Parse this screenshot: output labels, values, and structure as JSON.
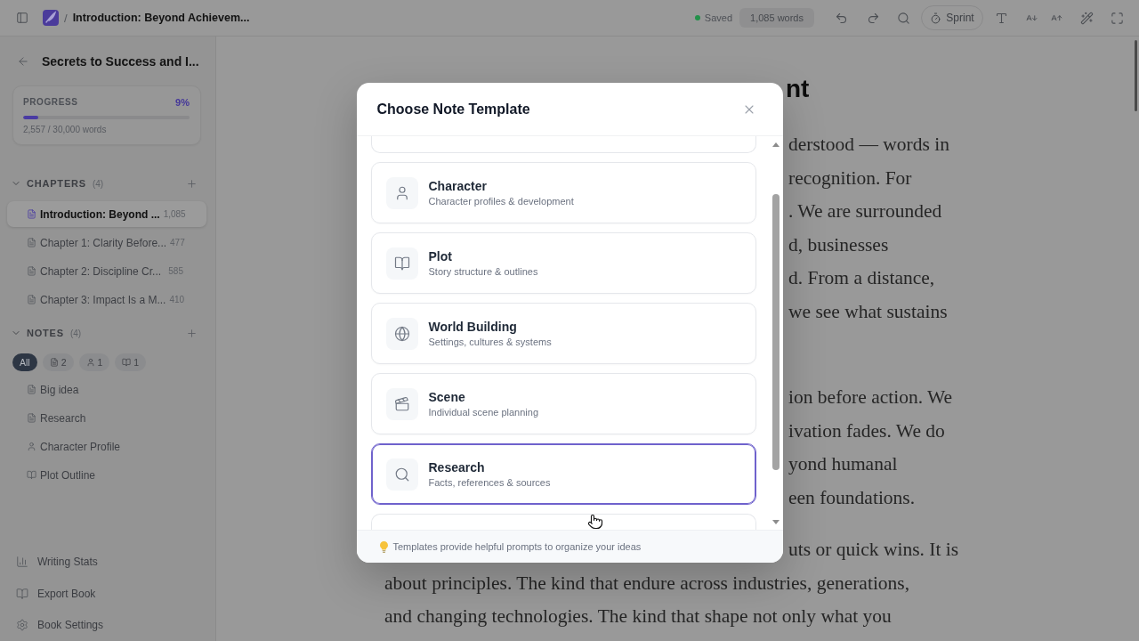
{
  "top_bar": {
    "separator": "/",
    "document_title": "Introduction: Beyond Achievem...",
    "save_status": {
      "label": "Saved",
      "saved": true
    },
    "word_count": "1,085 words",
    "sprint": "Sprint"
  },
  "sidebar": {
    "book_title": "Secrets to Success and I...",
    "progress": {
      "label": "PROGRESS",
      "percent": "9%",
      "level": 0.09,
      "words": "2,557 / 30,000 words"
    },
    "chapters": {
      "title": "CHAPTERS",
      "count": "(4)",
      "expanded": true,
      "items": [
        {
          "title": "Introduction: Beyond ...",
          "words": "1,085",
          "selected": true
        },
        {
          "title": "Chapter 1: Clarity Before...",
          "words": "477",
          "selected": false
        },
        {
          "title": "Chapter 2: Discipline Cr...",
          "words": "585",
          "selected": false
        },
        {
          "title": "Chapter 3: Impact Is a M...",
          "words": "410",
          "selected": false
        }
      ]
    },
    "notes": {
      "title": "NOTES",
      "count": "(4)",
      "expanded": true,
      "filters": [
        {
          "kind": "all",
          "label": "All",
          "selected": true
        },
        {
          "kind": "document",
          "label": "2",
          "selected": false
        },
        {
          "kind": "character",
          "label": "1",
          "selected": false
        },
        {
          "kind": "plot",
          "label": "1",
          "selected": false
        }
      ],
      "items": [
        {
          "kind": "document",
          "title": "Big idea"
        },
        {
          "kind": "document",
          "title": "Research"
        },
        {
          "kind": "character",
          "title": "Character Profile"
        },
        {
          "kind": "plot",
          "title": "Plot Outline"
        }
      ]
    },
    "links": [
      {
        "kind": "stats",
        "label": "Writing Stats"
      },
      {
        "kind": "export",
        "label": "Export Book"
      },
      {
        "kind": "settings",
        "label": "Book Settings"
      }
    ]
  },
  "editor": {
    "heading": "nt",
    "paragraphs": [
      {
        "lines": [
          {
            "kind": "cut",
            "text": "derstood — words in"
          },
          {
            "kind": "cut",
            "text": "recognition. For"
          },
          {
            "kind": "cut",
            "text": ". We are surrounded"
          },
          {
            "kind": "cut",
            "text": "d, businesses"
          },
          {
            "kind": "cut",
            "text": "d. From a distance,"
          },
          {
            "kind": "cut",
            "text": "we see what sustains"
          }
        ]
      },
      {
        "lines": [
          {
            "kind": "cut",
            "text": "ion before action. We"
          },
          {
            "kind": "cut",
            "text": "ivation fades. We do"
          },
          {
            "kind": "cut",
            "text": "yond humanal"
          },
          {
            "kind": "cut",
            "text": "een foundations."
          }
        ]
      },
      {
        "lines": [
          {
            "kind": "cut",
            "text": "uts or quick wins. It is"
          },
          {
            "kind": "full",
            "text": "about principles. The kind that endure across industries, generations,"
          },
          {
            "kind": "full",
            "text": "and changing technologies. The kind that shape not only what you"
          }
        ]
      }
    ]
  },
  "modal": {
    "title": "Choose Note Template",
    "templates": {
      "more_above": true,
      "more_below": true,
      "items": [
        {
          "kind": "character",
          "title": "Character",
          "description": "Character profiles & development",
          "selected": false
        },
        {
          "kind": "plot",
          "title": "Plot",
          "description": "Story structure & outlines",
          "selected": false
        },
        {
          "kind": "world",
          "title": "World Building",
          "description": "Settings, cultures & systems",
          "selected": false
        },
        {
          "kind": "scene",
          "title": "Scene",
          "description": "Individual scene planning",
          "selected": false
        },
        {
          "kind": "research",
          "title": "Research",
          "description": "Facts, references & sources",
          "selected": true
        }
      ]
    },
    "tip": "Templates provide helpful prompts to organize your ideas"
  }
}
